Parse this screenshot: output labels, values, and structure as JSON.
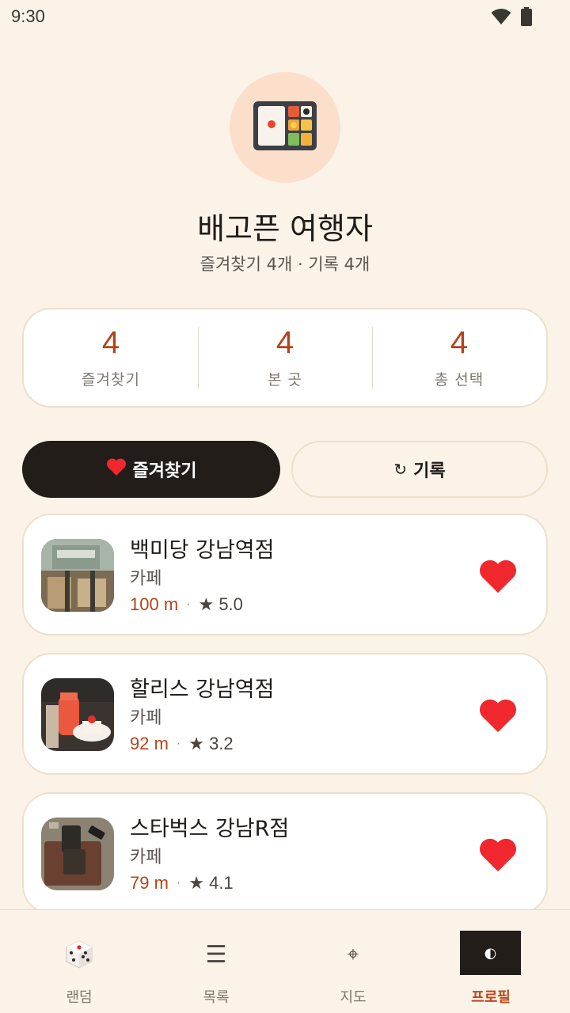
{
  "status_bar": {
    "time": "9:30",
    "wifi_icon": "wifi-icon",
    "battery_icon": "battery-icon"
  },
  "profile": {
    "avatar_icon": "bento-box-icon",
    "name": "배고픈 여행자",
    "summary": "즐겨찾기 4개 · 기록 4개"
  },
  "stats": [
    {
      "value": "4",
      "label": "즐겨찾기"
    },
    {
      "value": "4",
      "label": "본 곳"
    },
    {
      "value": "4",
      "label": "총 선택"
    }
  ],
  "tabs": {
    "favorites": {
      "label": "즐겨찾기",
      "icon": "heart-icon",
      "active": true
    },
    "history": {
      "label": "기록",
      "icon_glyph": "↻",
      "icon": "refresh-icon",
      "active": false
    }
  },
  "places": [
    {
      "name": "백미당 강남역점",
      "category": "카페",
      "distance": "100 m",
      "separator": "·",
      "rating": "★ 5.0",
      "favorited": true
    },
    {
      "name": "할리스 강남역점",
      "category": "카페",
      "distance": "92 m",
      "separator": "·",
      "rating": "★ 3.2",
      "favorited": true
    },
    {
      "name": "스타벅스 강남R점",
      "category": "카페",
      "distance": "79 m",
      "separator": "·",
      "rating": "★ 4.1",
      "favorited": true
    }
  ],
  "bottom_nav": [
    {
      "label": "랜덤",
      "icon": "dice-icon"
    },
    {
      "label": "목록",
      "icon": "list-icon",
      "glyph": "☰"
    },
    {
      "label": "지도",
      "icon": "crosshair-icon",
      "glyph": "⌖"
    },
    {
      "label": "프로필",
      "icon": "contrast-icon",
      "glyph": "◐",
      "active": true
    }
  ],
  "colors": {
    "background": "#FBF3E8",
    "accent": "#B5441A",
    "dark": "#221D19",
    "heart": "#F0282D"
  }
}
